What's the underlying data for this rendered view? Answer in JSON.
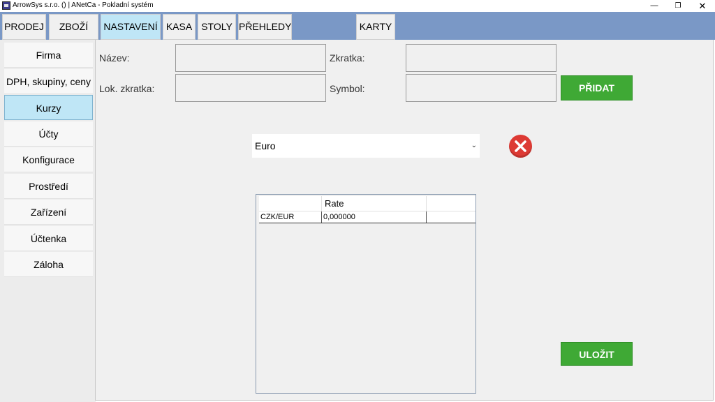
{
  "window": {
    "title": "ArrowSys s.r.o. () | ANetCa - Pokladní systém",
    "minimize_glyph": "—",
    "maximize_glyph": "❐",
    "close_glyph": "✕"
  },
  "menu": {
    "tabs": [
      {
        "label": "PRODEJ"
      },
      {
        "label": "ZBOŽÍ"
      },
      {
        "label": "NASTAVENÍ"
      },
      {
        "label": "KASA"
      },
      {
        "label": "STOLY"
      },
      {
        "label": "PŘEHLEDY"
      },
      {
        "label": "KARTY"
      }
    ],
    "active": "NASTAVENÍ"
  },
  "sidebar": {
    "items": [
      {
        "label": "Firma"
      },
      {
        "label": "DPH, skupiny, ceny"
      },
      {
        "label": "Kurzy"
      },
      {
        "label": "Účty"
      },
      {
        "label": "Konfigurace"
      },
      {
        "label": "Prostředí"
      },
      {
        "label": "Zařízení"
      },
      {
        "label": "Účtenka"
      },
      {
        "label": "Záloha"
      }
    ],
    "active": "Kurzy"
  },
  "form": {
    "name_label": "Název:",
    "name_value": "",
    "abbr_label": "Zkratka:",
    "abbr_value": "",
    "local_abbr_label": "Lok. zkratka:",
    "local_abbr_value": "",
    "symbol_label": "Symbol:",
    "symbol_value": "",
    "add_label": "PŘIDAT"
  },
  "currency_select": {
    "selected": "Euro",
    "arrow": "⌄"
  },
  "rates_table": {
    "columns": [
      "",
      "Rate",
      ""
    ],
    "rows": [
      {
        "pair": "CZK/EUR",
        "rate": "0,000000",
        "extra": ""
      }
    ]
  },
  "save_label": "ULOŽIT",
  "colors": {
    "menu_bar": "#7a98c6",
    "active_tab": "#bfe6f6",
    "green_button": "#3fa935",
    "delete_button": "#dd3a34"
  }
}
